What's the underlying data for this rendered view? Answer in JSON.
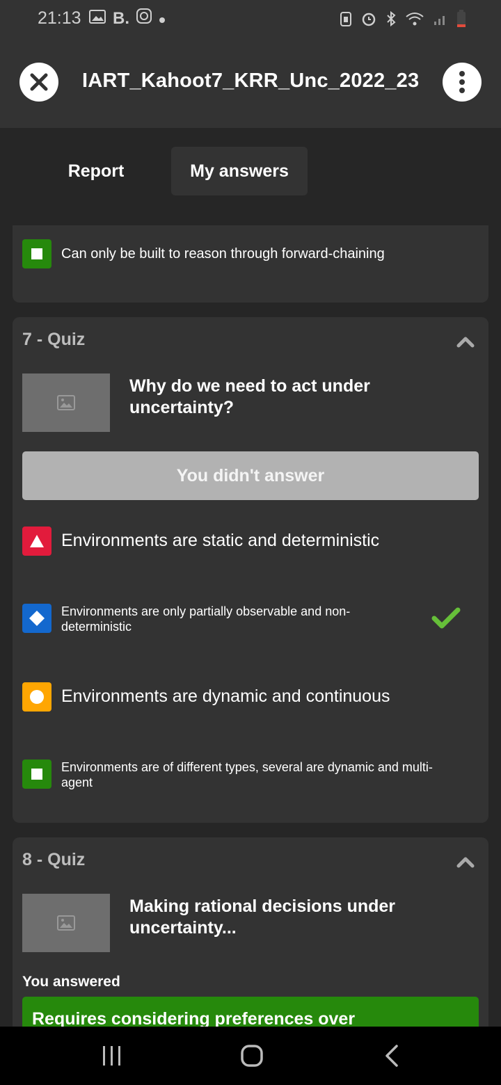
{
  "status": {
    "time": "21:13",
    "brand_letter": "B."
  },
  "app": {
    "title": "IART_Kahoot7_KRR_Unc_2022_23"
  },
  "tabs": [
    {
      "label": "Report"
    },
    {
      "label": "My answers"
    }
  ],
  "prev_card": {
    "answer": {
      "text": "Can only be built to reason through forward-chaining",
      "shape": "square",
      "color": "#26890c"
    }
  },
  "questions": [
    {
      "header": "7 - Quiz",
      "text_line1": "Why do we need to act under",
      "text_line2": "uncertainty?",
      "result": "You didn't answer",
      "answers": [
        {
          "text": "Environments are static and deterministic",
          "shape": "triangle",
          "color": "#e21b3c",
          "correct": false
        },
        {
          "text": "Environments are only partially observable and non-deterministic",
          "shape": "diamond",
          "color": "#1368ce",
          "correct": true
        },
        {
          "text": "Environments are dynamic and continuous",
          "shape": "circle",
          "color": "#ffa602",
          "correct": false
        },
        {
          "text": "Environments are of different types, several are dynamic and multi-agent",
          "shape": "square",
          "color": "#26890c",
          "correct": false
        }
      ]
    },
    {
      "header": "8 - Quiz",
      "text": "Making rational decisions under uncertainty...",
      "you_answered_label": "You answered",
      "answered_text": "Requires considering preferences over",
      "answered_color": "#26890c"
    }
  ],
  "colors": {
    "correct_check": "#66bf39",
    "background": "#262626",
    "card": "#333333"
  }
}
